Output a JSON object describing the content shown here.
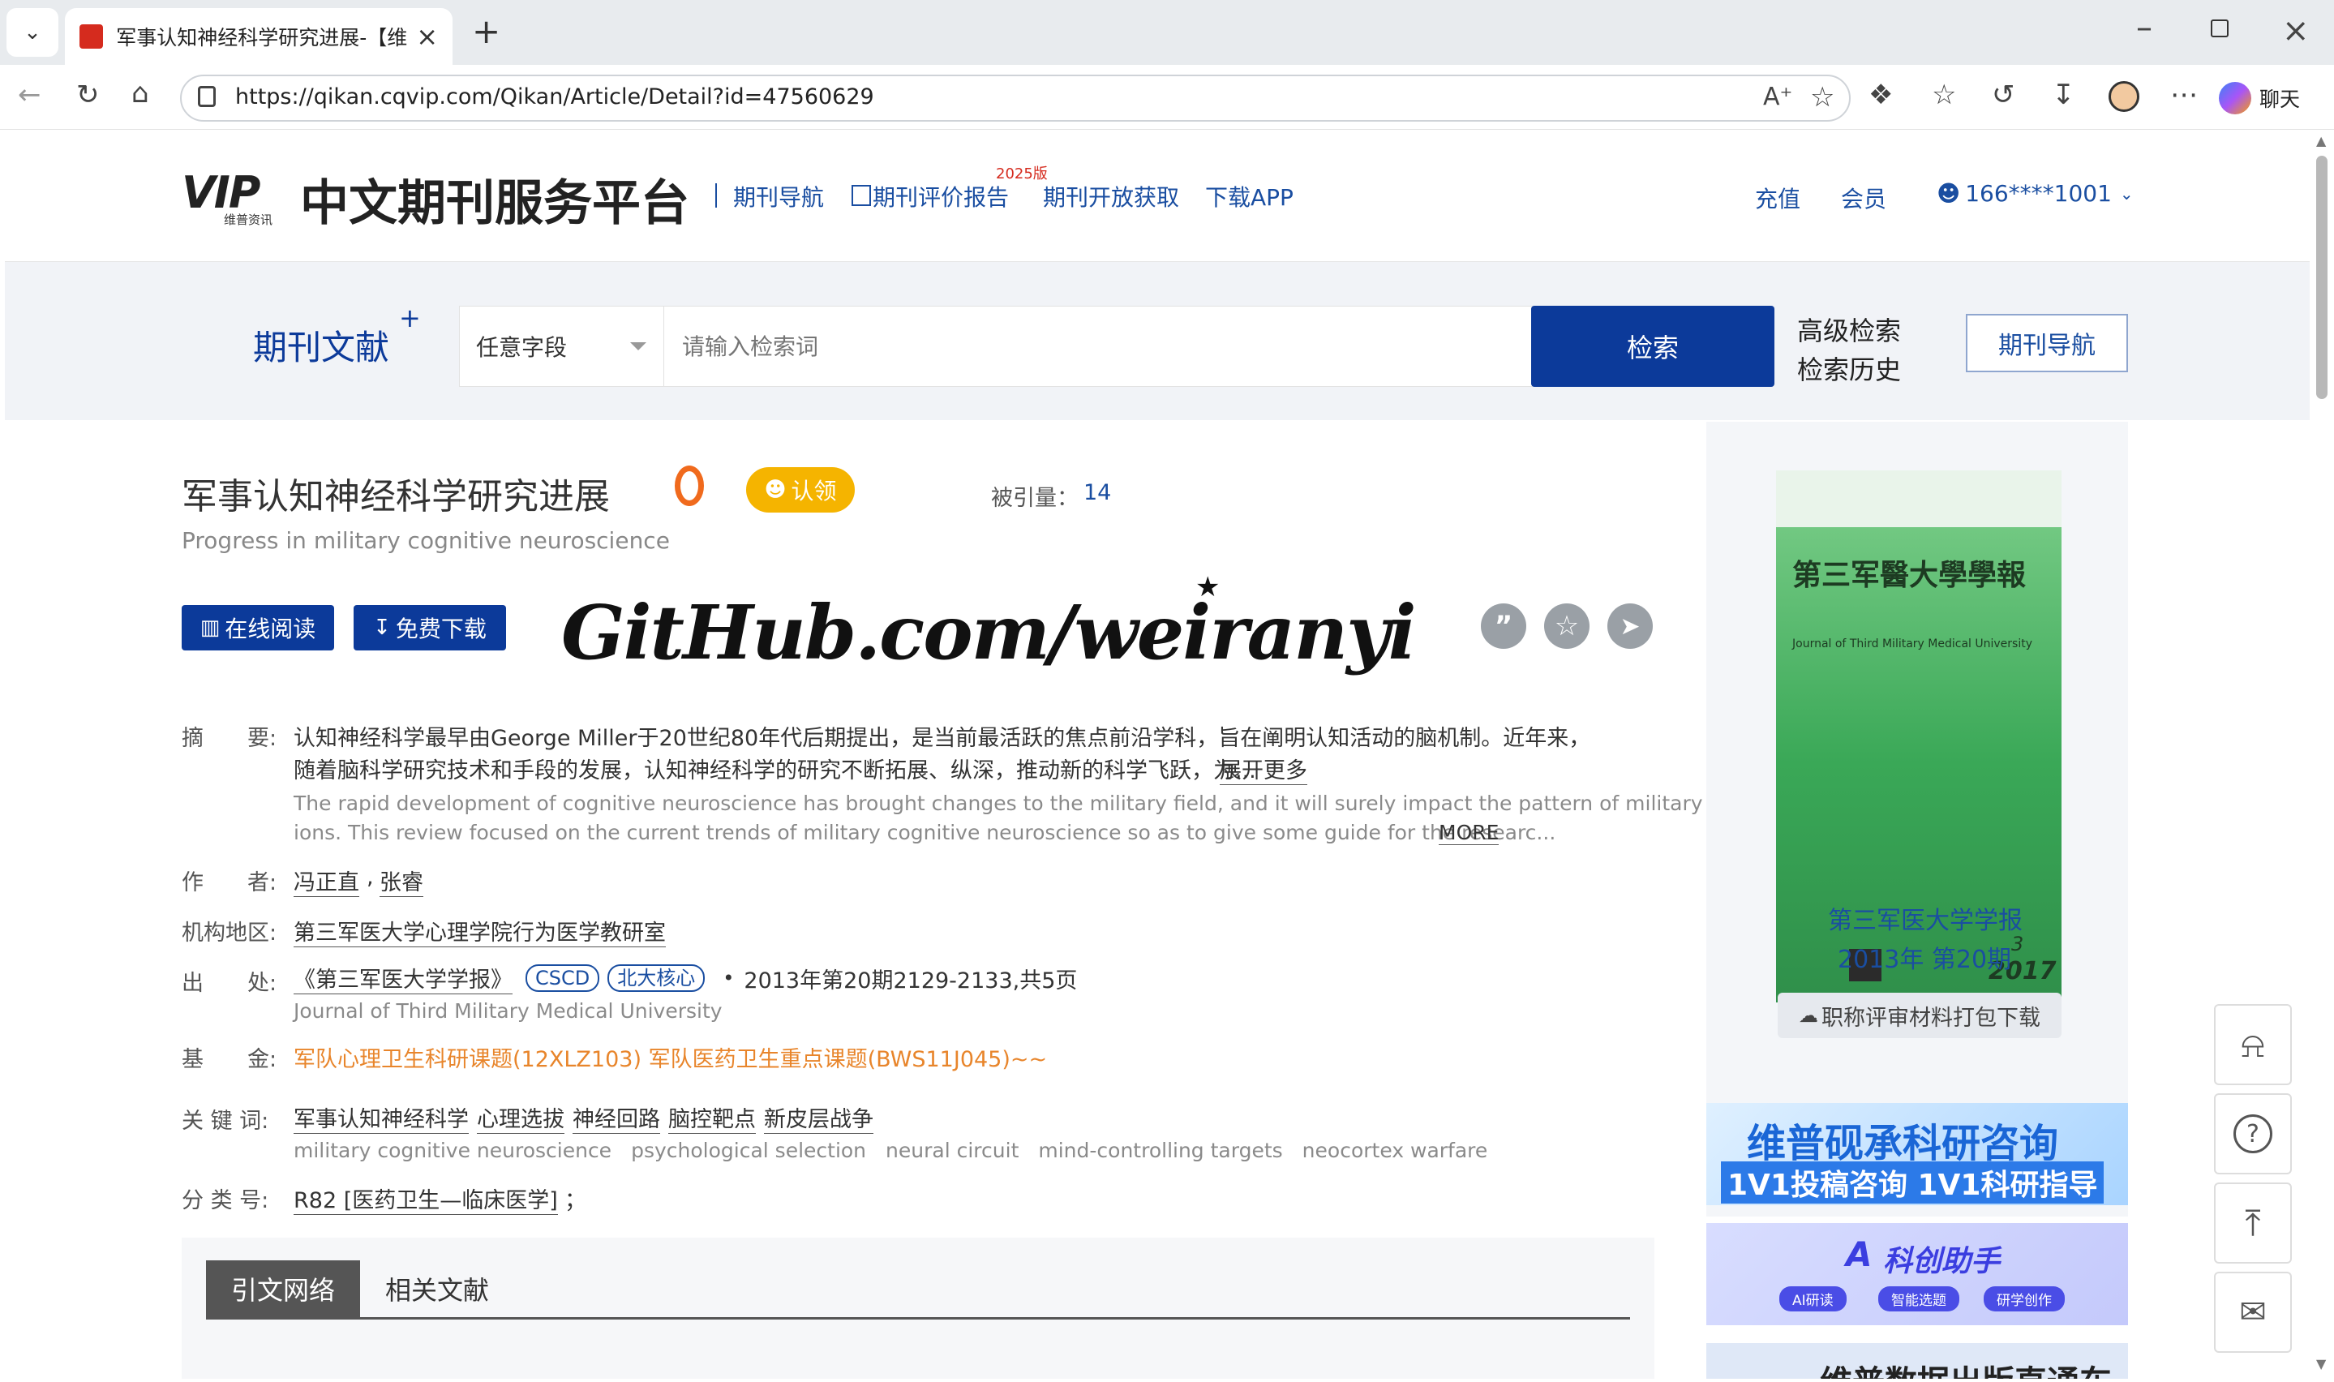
{
  "browser": {
    "tab_title": "军事认知神经科学研究进展-【维普",
    "url": "https://qikan.cqvip.com/Qikan/Article/Detail?id=47560629",
    "chat_label": "聊天"
  },
  "site": {
    "logo_vip": "VIP",
    "logo_sub": "维普资讯",
    "platform_name": "中文期刊服务平台",
    "nav": [
      "期刊导航",
      "期刊评价报告",
      "期刊开放获取",
      "下载APP"
    ],
    "nav_badge": "2025版",
    "recharge": "充值",
    "member": "会员",
    "user": "166****1001"
  },
  "search": {
    "section_label": "期刊文献",
    "section_plus": "+",
    "field_select": "任意字段",
    "placeholder": "请输入检索词",
    "search_button": "检索",
    "advanced": "高级检索",
    "history": "检索历史",
    "journal_nav_button": "期刊导航"
  },
  "article": {
    "title": "军事认知神经科学研究进展",
    "claim_label": "认领",
    "cited_label": "被引量：",
    "cited_count": "14",
    "title_en": "Progress in military cognitive neuroscience",
    "read_online": "在线阅读",
    "free_download": "免费下载",
    "watermark": "GitHub.com/weiranyi",
    "abstract_label": "摘　　要:",
    "abstract_cn_line1": "认知神经科学最早由George Miller于20世纪80年代后期提出，是当前最活跃的焦点前沿学科，旨在阐明认知活动的脑机制。近年来，",
    "abstract_cn_line2": "随着脑科学研究技术和手段的发展，认知神经科学的研究不断拓展、纵深，推动新的科学飞跃，为...",
    "abstract_more_cn": "展开更多",
    "abstract_en_line1": "The rapid development of cognitive neuroscience has brought changes to the military field, and it will surely impact the pattern of military operat",
    "abstract_en_line2": "ions. This review focused on the current trends of military cognitive neuroscience so as to give some guide for the researc...",
    "abstract_more_en": "MORE",
    "authors_label": "作　　者:",
    "authors": [
      "冯正直",
      "张睿"
    ],
    "org_label": "机构地区:",
    "org": "第三军医大学心理学院行为医学教研室",
    "source_label": "出　　处:",
    "source_journal": "《第三军医大学学报》",
    "source_tags": [
      "CSCD",
      "北大核心"
    ],
    "source_detail": "2013年第20期2129-2133,共5页",
    "source_en": "Journal of Third Military Medical University",
    "fund_label": "基　　金:",
    "fund": "军队心理卫生科研课题(12XLZ103) 军队医药卫生重点课题(BWS11J045)~~",
    "keywords_label": "关 键 词:",
    "keywords": [
      "军事认知神经科学",
      "心理选拔",
      "神经回路",
      "脑控靶点",
      "新皮层战争"
    ],
    "keywords_en": [
      "military cognitive neuroscience",
      "psychological selection",
      "neural circuit",
      "mind-controlling targets",
      "neocortex warfare"
    ],
    "class_label": "分 类 号:",
    "class_value": "R82 [医药卫生—临床医学]",
    "class_suffix": "；",
    "tabs": [
      "引文网络",
      "相关文献"
    ]
  },
  "sidebar": {
    "cover_title": "第三军醫大學學報",
    "cover_en": "Journal of Third Military Medical University",
    "cover_issue": "3",
    "cover_year": "2017",
    "journal_name": "第三军医大学学报",
    "issue": "2013年 第20期",
    "download_pack": "职称评审材料打包下载",
    "banner1_line1": "维普砚承科研咨询",
    "banner1_line2": "1V1投稿咨询  1V1科研指导",
    "banner2_title": "科创助手",
    "banner2_pills": [
      "AI研读",
      "智能选题",
      "研学创作"
    ],
    "banner3_text": "维普数据出版直通车"
  },
  "colors": {
    "brand_blue": "#0c3a9a",
    "link_blue": "#1a4ea1",
    "orange": "#e8852b",
    "claim_yellow": "#f5b400"
  }
}
